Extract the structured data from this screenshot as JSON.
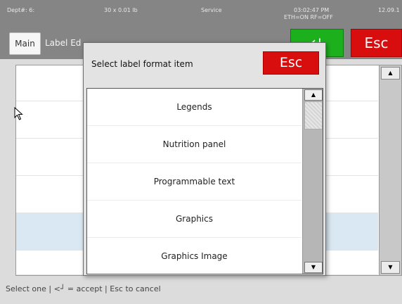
{
  "status": {
    "dept": "Dept#: 6:",
    "scale": "30 x 0.01 lb",
    "mode": "Service",
    "time": "03:02:47 PM",
    "date": "12.09.1",
    "network": "ETH=ON  RF=OFF"
  },
  "header": {
    "tab_main": "Main",
    "tab_label": "Label Ed",
    "enter_label": "↵",
    "esc_label": "Esc"
  },
  "dialog": {
    "title": "Select label format item",
    "esc_label": "Esc",
    "items": [
      {
        "label": "Legends"
      },
      {
        "label": "Nutrition panel"
      },
      {
        "label": "Programmable text"
      },
      {
        "label": "Graphics"
      },
      {
        "label": "Graphics Image"
      }
    ],
    "scroll_up": "▲",
    "scroll_down": "▼"
  },
  "background_list": {
    "scroll_up": "▲",
    "scroll_down": "▼"
  },
  "footer": {
    "hint": "Select one | <┘ = accept | Esc to cancel"
  }
}
